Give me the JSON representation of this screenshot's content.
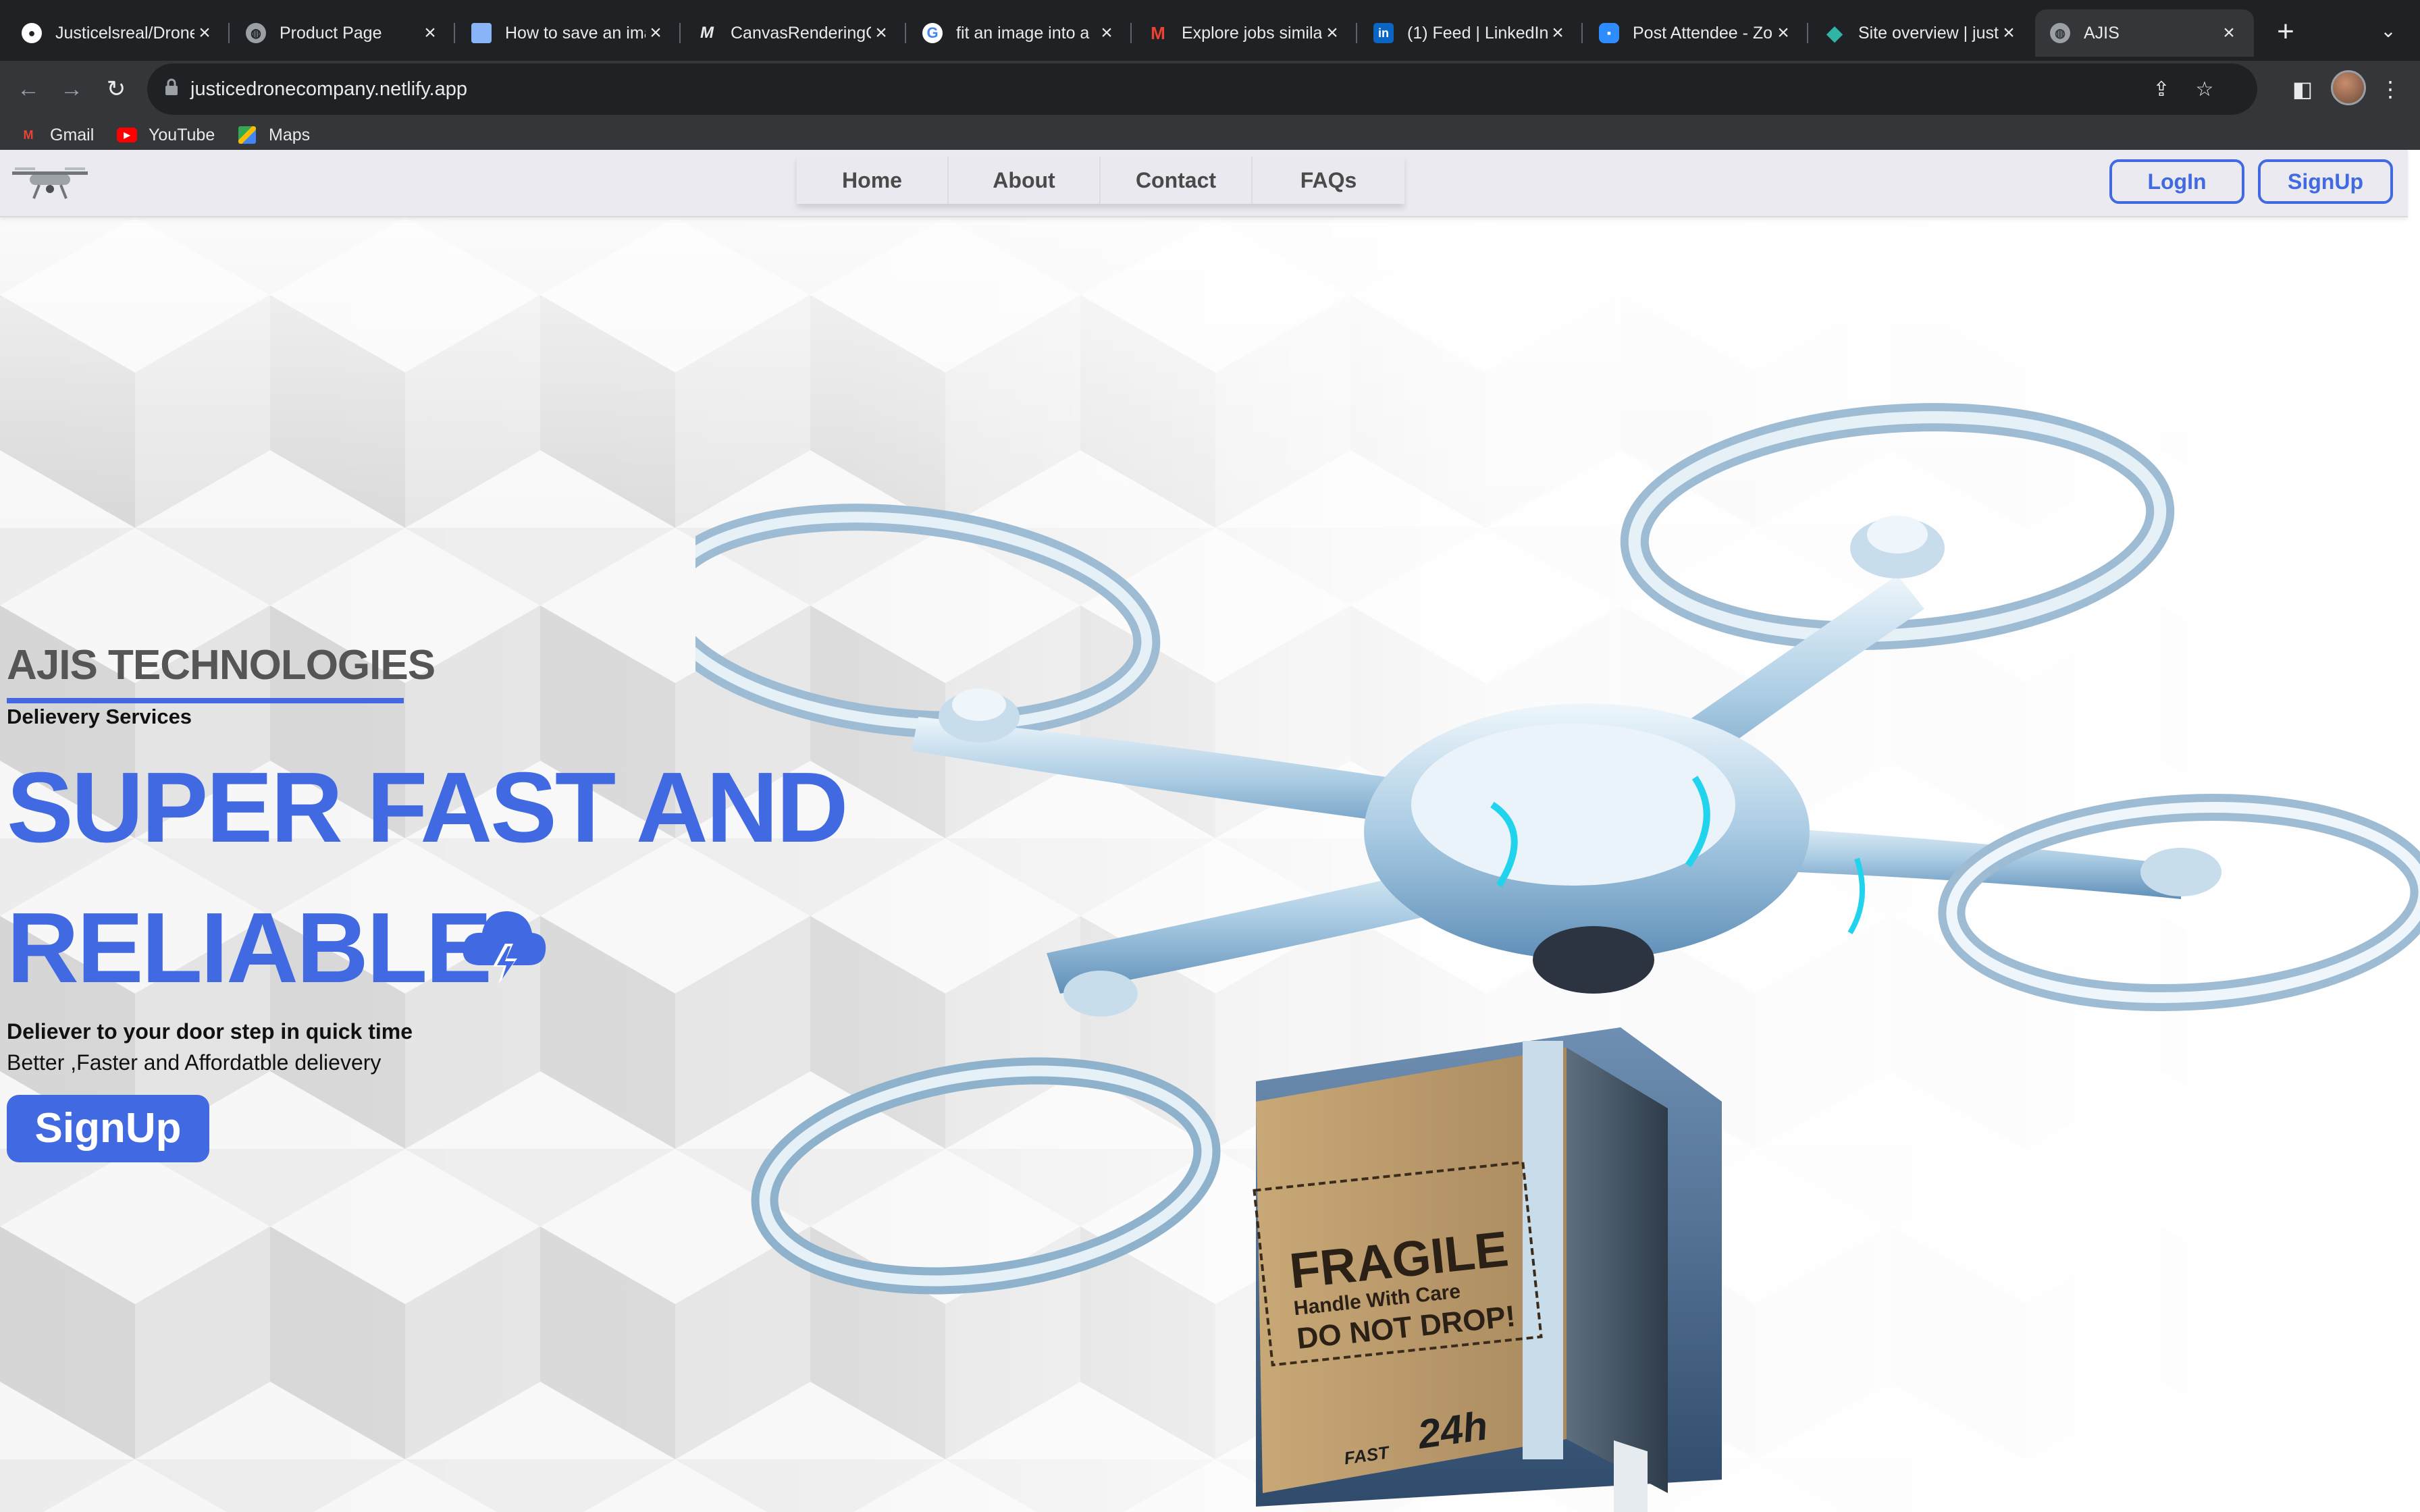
{
  "browser": {
    "tabs": [
      {
        "title": "Justicelsreal/Drone",
        "icon": "github-icon",
        "color": "#ffffff"
      },
      {
        "title": "Product Page",
        "icon": "globe-icon",
        "color": "#9aa0a6"
      },
      {
        "title": "How to save an image",
        "icon": "page-icon",
        "color": "#8ab4f8"
      },
      {
        "title": "CanvasRenderingContext",
        "icon": "mdn-icon",
        "color": "#e8eaed"
      },
      {
        "title": "fit an image into a",
        "icon": "google-icon",
        "color": "#4285f4"
      },
      {
        "title": "Explore jobs similar",
        "icon": "gmail-icon",
        "color": "#ea4335"
      },
      {
        "title": "(1) Feed | LinkedIn",
        "icon": "linkedin-icon",
        "color": "#0a66c2"
      },
      {
        "title": "Post Attendee - Zoom",
        "icon": "zoom-icon",
        "color": "#2d8cff"
      },
      {
        "title": "Site overview | justice",
        "icon": "netlify-icon",
        "color": "#2fb5a6"
      },
      {
        "title": "AJIS",
        "icon": "globe-icon",
        "color": "#9aa0a6",
        "active": true
      }
    ],
    "new_tab_label": "+",
    "url": "justicedronecompany.netlify.app",
    "bookmarks": [
      {
        "label": "Gmail",
        "icon": "gmail-icon"
      },
      {
        "label": "YouTube",
        "icon": "youtube-icon"
      },
      {
        "label": "Maps",
        "icon": "maps-icon"
      }
    ]
  },
  "site": {
    "nav": [
      "Home",
      "About",
      "Contact",
      "FAQs"
    ],
    "login_label": "LogIn",
    "signup_label": "SignUp",
    "brand": "AJIS TECHNOLOGIES",
    "tagline": "Delievery Services",
    "headline_line1": "SUPER FAST AND",
    "headline_line2": "RELIABLE",
    "sub_bold": "Deliever to your door step in quick time",
    "sub_regular": "Better ,Faster and Affordatble delievery",
    "cta_label": "SignUp",
    "box_text_1": "FRAGILE",
    "box_text_2": "Handle With Care",
    "box_text_3": "DO NOT DROP!",
    "box_badge": "24h",
    "box_badge_sub": "FAST",
    "accent_color": "#4169e1"
  }
}
